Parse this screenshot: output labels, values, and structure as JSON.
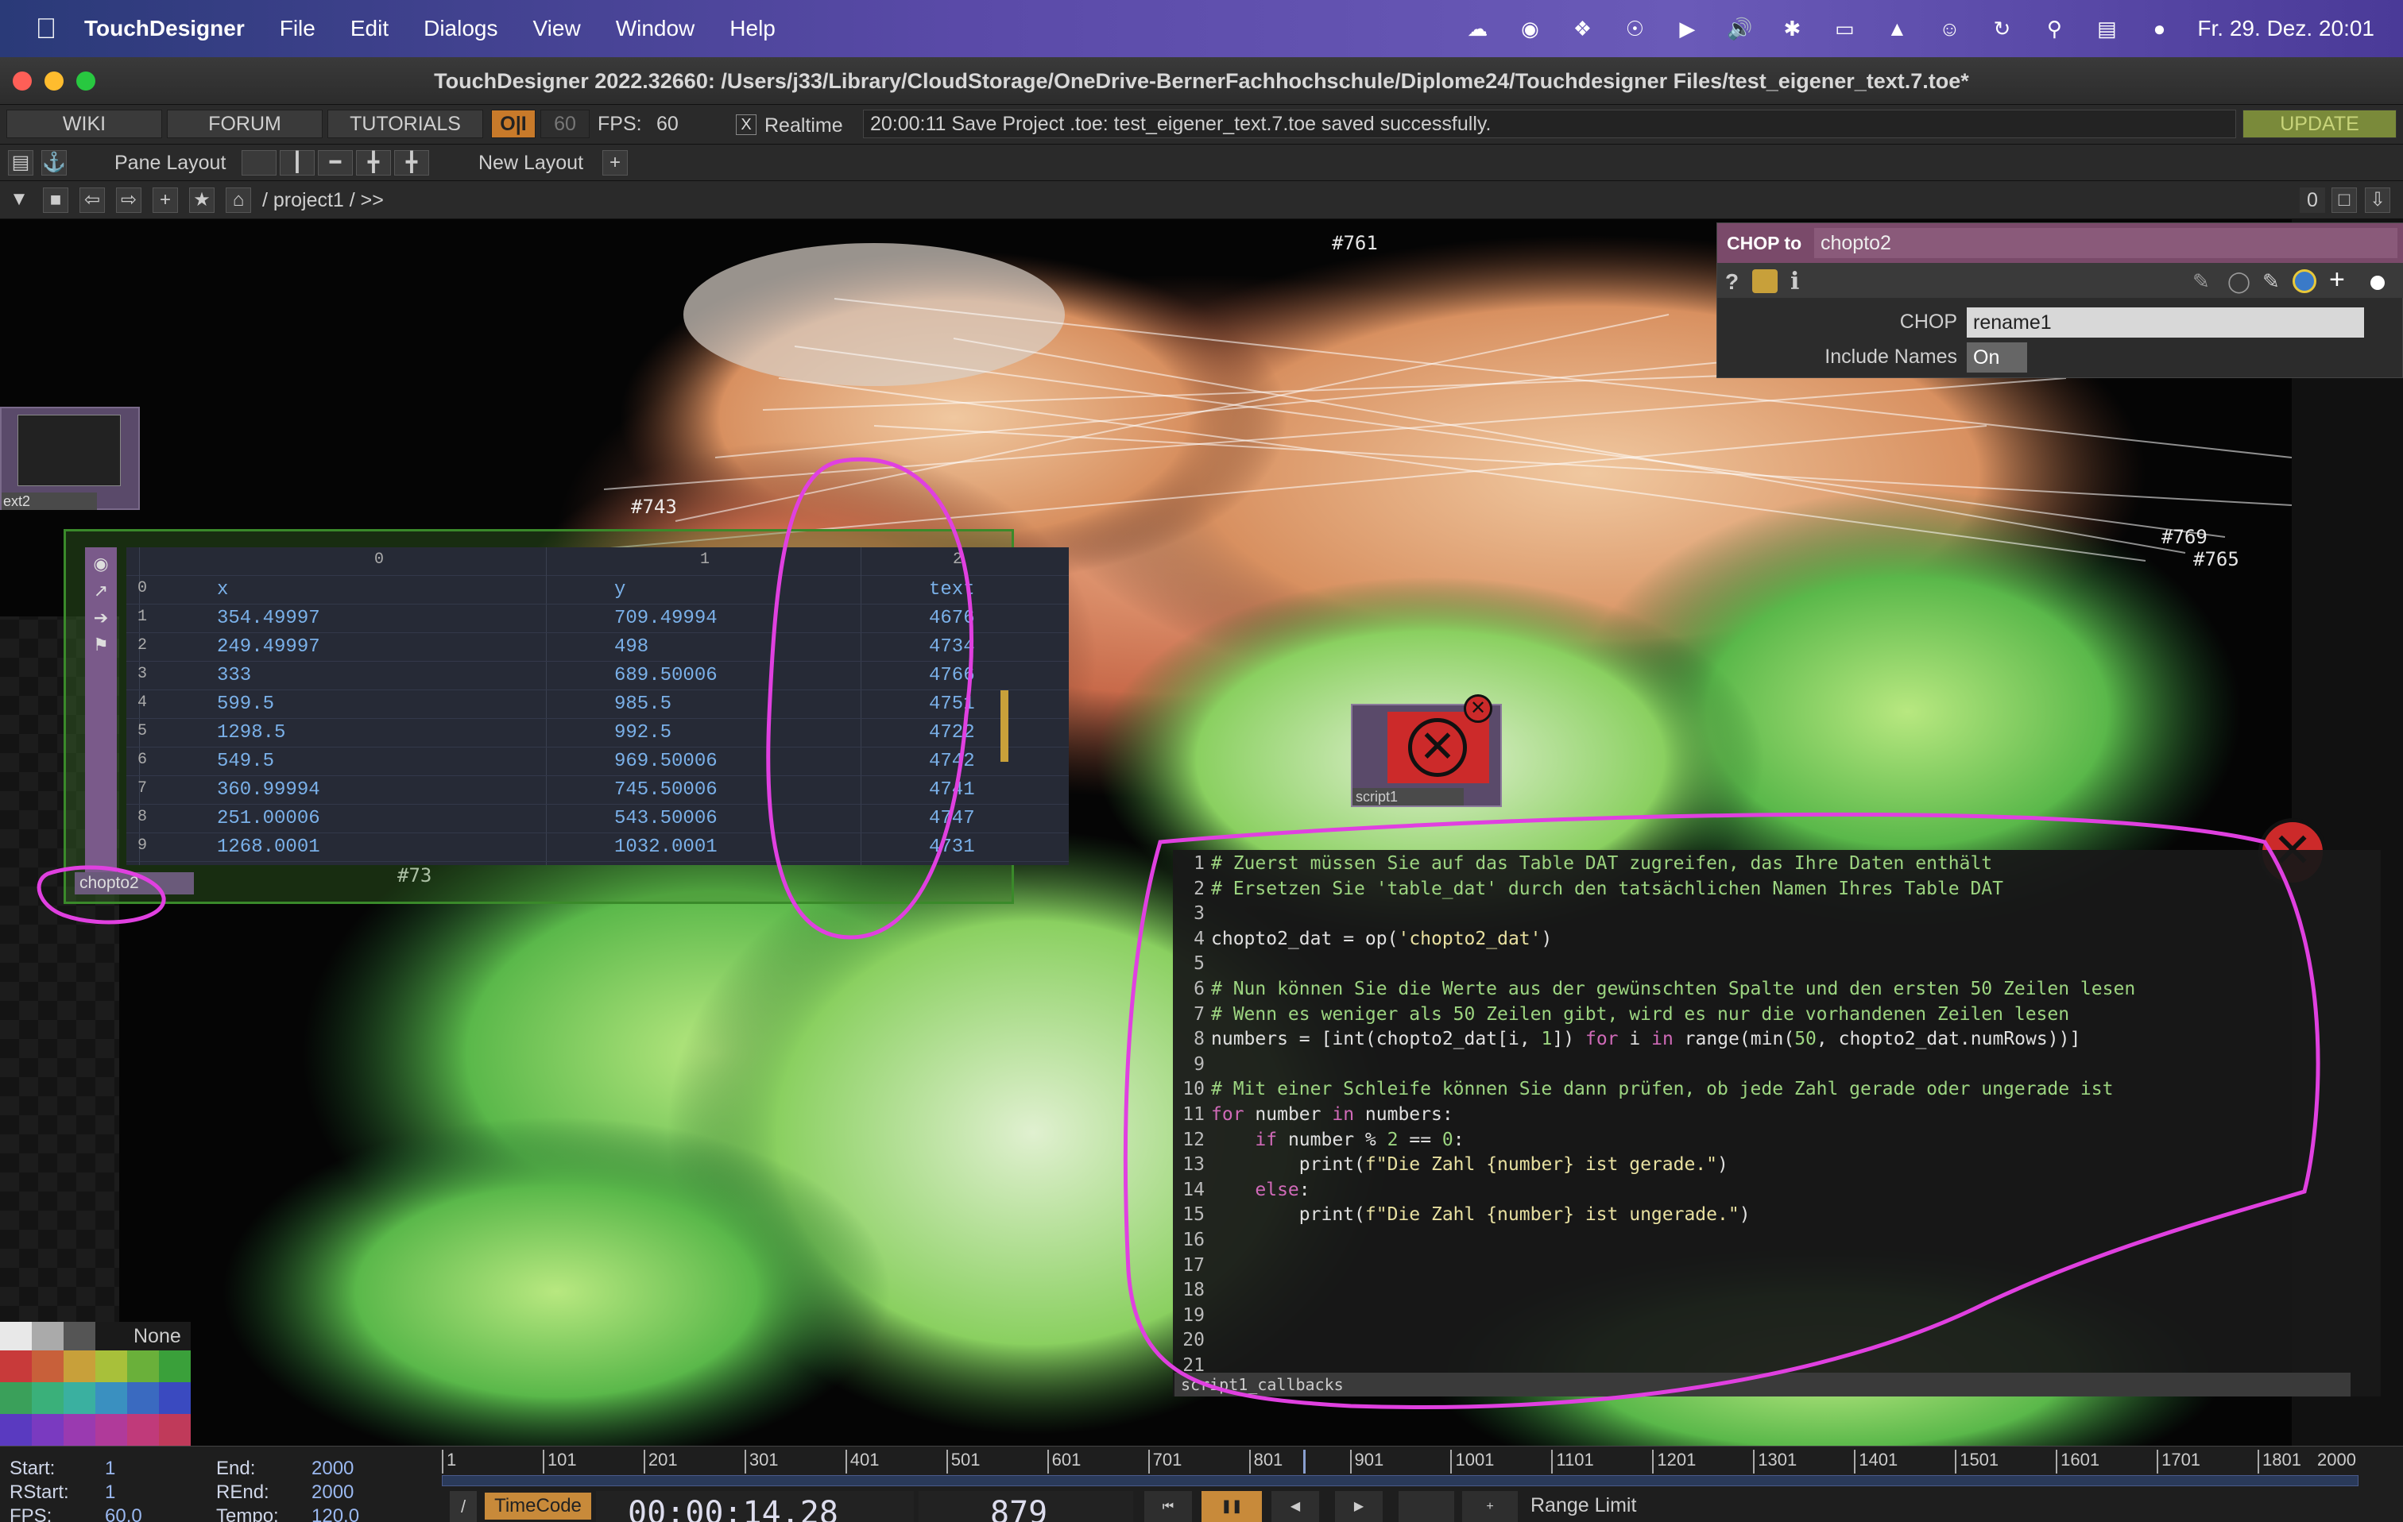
{
  "menubar": {
    "app": "TouchDesigner",
    "items": [
      "File",
      "Edit",
      "Dialogs",
      "View",
      "Window",
      "Help"
    ],
    "clock": "Fr. 29. Dez.  20:01"
  },
  "window": {
    "title": "TouchDesigner 2022.32660: /Users/j33/Library/CloudStorage/OneDrive-BernerFachhochschule/Diplome24/Touchdesigner Files/test_eigener_text.7.toe*"
  },
  "topbar": {
    "wiki": "WIKI",
    "forum": "FORUM",
    "tutorials": "TUTORIALS",
    "oi": "O|I",
    "fps_target": "60",
    "fps_label": "FPS:",
    "fps_value": "60",
    "realtime": "Realtime",
    "realtime_check": "X",
    "status": "20:00:11 Save Project .toe: test_eigener_text.7.toe saved successfully.",
    "update": "UPDATE"
  },
  "panebar": {
    "pane_layout": "Pane Layout",
    "new_layout": "New Layout",
    "plus": "+"
  },
  "pathbar": {
    "path": "/ project1 / >>",
    "counter": "0"
  },
  "params": {
    "type": "CHOP to",
    "name": "chopto2",
    "chop_label": "CHOP",
    "chop_value": "rename1",
    "include_label": "Include Names",
    "include_value": "On"
  },
  "nodes": {
    "text2": "ext2",
    "chopto2": "chopto2",
    "script1": "script1",
    "code_op": "script1_callbacks"
  },
  "table": {
    "col_index": [
      "0",
      "1",
      "2"
    ],
    "rows": [
      [
        "0",
        "x",
        "y",
        "text"
      ],
      [
        "1",
        "354.49997",
        "709.49994",
        "4676"
      ],
      [
        "2",
        "249.49997",
        "498",
        "4734"
      ],
      [
        "3",
        "333",
        "689.50006",
        "4766"
      ],
      [
        "4",
        "599.5",
        "985.5",
        "4751"
      ],
      [
        "5",
        "1298.5",
        "992.5",
        "4722"
      ],
      [
        "6",
        "549.5",
        "969.50006",
        "4742"
      ],
      [
        "7",
        "360.99994",
        "745.50006",
        "4741"
      ],
      [
        "8",
        "251.00006",
        "543.50006",
        "4747"
      ],
      [
        "9",
        "1268.0001",
        "1032.0001",
        "4731"
      ]
    ]
  },
  "code": {
    "lines": [
      "# Zuerst müssen Sie auf das Table DAT zugreifen, das Ihre Daten enthält",
      "# Ersetzen Sie 'table_dat' durch den tatsächlichen Namen Ihres Table DAT",
      "",
      "chopto2_dat = op('chopto2_dat')",
      "",
      "# Nun können Sie die Werte aus der gewünschten Spalte und den ersten 50 Zeilen lesen",
      "# Wenn es weniger als 50 Zeilen gibt, wird es nur die vorhandenen Zeilen lesen",
      "numbers = [int(chopto2_dat[i, 1]) for i in range(min(50, chopto2_dat.numRows))]",
      "",
      "# Mit einer Schleife können Sie dann prüfen, ob jede Zahl gerade oder ungerade ist",
      "for number in numbers:",
      "    if number % 2 == 0:",
      "        print(f\"Die Zahl {number} ist gerade.\")",
      "    else:",
      "        print(f\"Die Zahl {number} ist ungerade.\")",
      "",
      "",
      "",
      "",
      "",
      ""
    ]
  },
  "canvas_labels": [
    "#761",
    "#769",
    "#765",
    "#743",
    "#73"
  ],
  "palette": {
    "none": "None"
  },
  "timeline": {
    "ruler": [
      "1",
      "101",
      "201",
      "301",
      "401",
      "501",
      "601",
      "701",
      "801",
      "901",
      "1001",
      "1101",
      "1201",
      "1301",
      "1401",
      "1501",
      "1601",
      "1701",
      "1801",
      "2000"
    ],
    "start_label": "Start:",
    "start": "1",
    "end_label": "End:",
    "end": "2000",
    "rstart_label": "RStart:",
    "rstart": "1",
    "rend_label": "REnd:",
    "rend": "2000",
    "fps_label": "FPS:",
    "fps": "60.0",
    "tempo_label": "Tempo:",
    "tempo": "120.0",
    "timecode_label": "TimeCode",
    "timecode": "00:00:14.28",
    "frame": "879",
    "range_limit": "Range Limit"
  },
  "colors": {
    "annotation": "#e040e0",
    "node_green": "#3a8a2a",
    "error_red": "#cc2a2a"
  }
}
